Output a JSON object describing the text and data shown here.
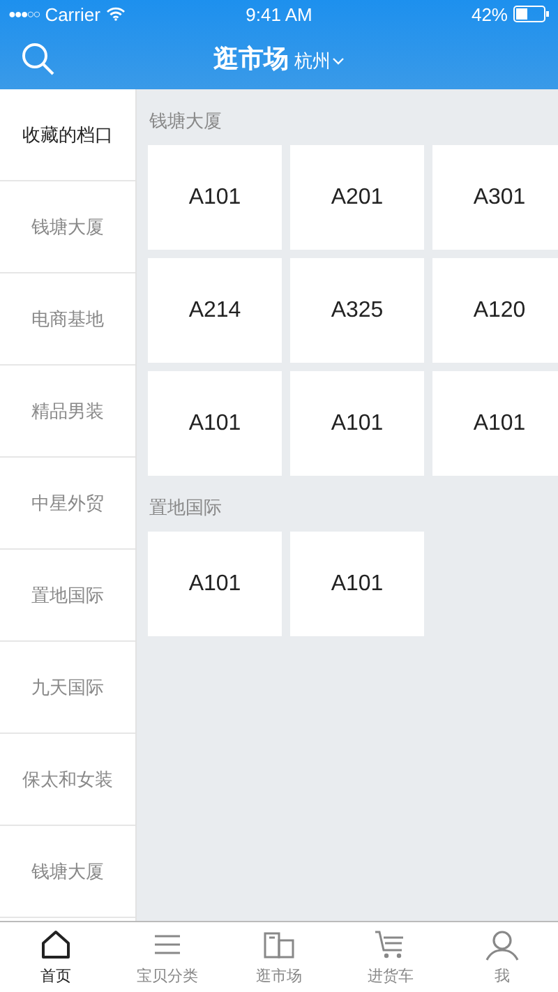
{
  "status_bar": {
    "signal": "●●●○○",
    "carrier": "Carrier",
    "time": "9:41 AM",
    "battery": "42%"
  },
  "nav_bar": {
    "title": "逛市场",
    "city": "杭州"
  },
  "sidebar": {
    "items": [
      {
        "label": "收藏的档口",
        "selected": true
      },
      {
        "label": "钱塘大厦",
        "selected": false
      },
      {
        "label": "电商基地",
        "selected": false
      },
      {
        "label": "精品男装",
        "selected": false
      },
      {
        "label": "中星外贸",
        "selected": false
      },
      {
        "label": "置地国际",
        "selected": false
      },
      {
        "label": "九天国际",
        "selected": false
      },
      {
        "label": "保太和女装",
        "selected": false
      },
      {
        "label": "钱塘大厦",
        "selected": false
      }
    ]
  },
  "sections": [
    {
      "title": "钱塘大厦",
      "stalls": [
        "A101",
        "A201",
        "A301",
        "A214",
        "A325",
        "A120",
        "A101",
        "A101",
        "A101"
      ]
    },
    {
      "title": "置地国际",
      "stalls": [
        "A101",
        "A101"
      ]
    }
  ],
  "tab_bar": [
    {
      "label": "首页",
      "selected": true
    },
    {
      "label": "宝贝分类",
      "selected": false
    },
    {
      "label": "逛市场",
      "selected": false
    },
    {
      "label": "进货车",
      "selected": false
    },
    {
      "label": "我",
      "selected": false
    }
  ]
}
